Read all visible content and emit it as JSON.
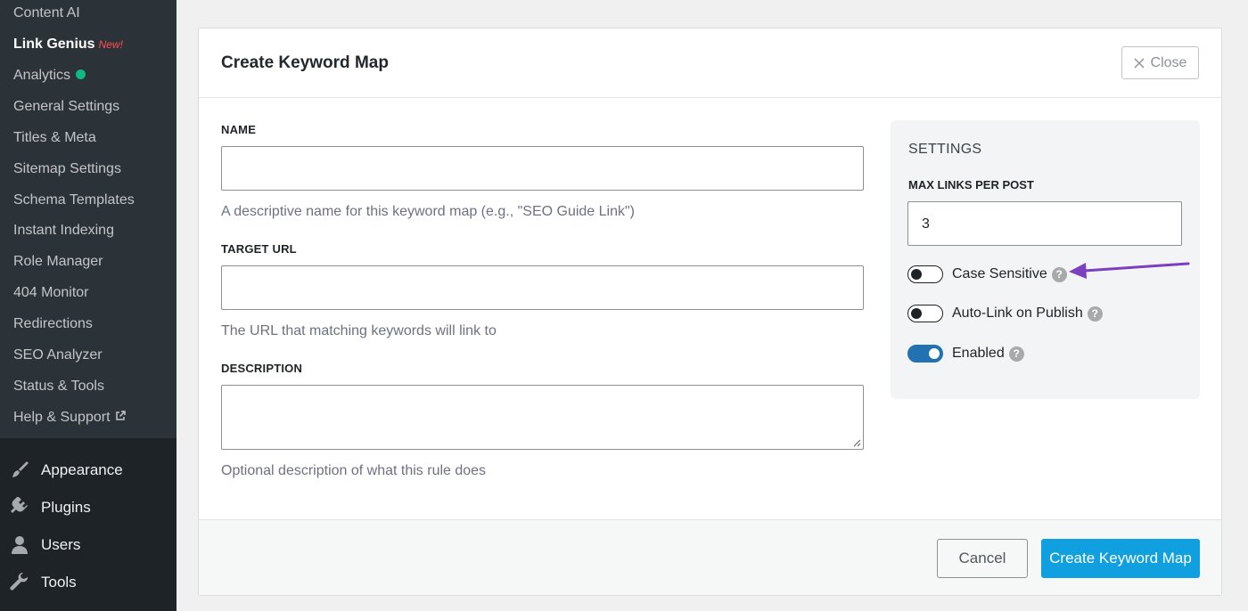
{
  "sidebar": {
    "submenu": [
      {
        "label": "Content AI"
      },
      {
        "label": "Link Genius",
        "badge": "New!"
      },
      {
        "label": "Analytics"
      },
      {
        "label": "General Settings"
      },
      {
        "label": "Titles & Meta"
      },
      {
        "label": "Sitemap Settings"
      },
      {
        "label": "Schema Templates"
      },
      {
        "label": "Instant Indexing"
      },
      {
        "label": "Role Manager"
      },
      {
        "label": "404 Monitor"
      },
      {
        "label": "Redirections"
      },
      {
        "label": "SEO Analyzer"
      },
      {
        "label": "Status & Tools"
      },
      {
        "label": "Help & Support"
      }
    ],
    "menu": [
      {
        "label": "Appearance",
        "icon": "paintbrush-icon"
      },
      {
        "label": "Plugins",
        "icon": "plugin-icon"
      },
      {
        "label": "Users",
        "icon": "user-icon"
      },
      {
        "label": "Tools",
        "icon": "wrench-icon"
      }
    ]
  },
  "modal": {
    "title": "Create Keyword Map",
    "close_label": "Close",
    "fields": {
      "name": {
        "label": "NAME",
        "value": "",
        "help": "A descriptive name for this keyword map (e.g., \"SEO Guide Link\")"
      },
      "target_url": {
        "label": "TARGET URL",
        "value": "",
        "help": "The URL that matching keywords will link to"
      },
      "description": {
        "label": "DESCRIPTION",
        "value": "",
        "help": "Optional description of what this rule does"
      }
    },
    "settings": {
      "title": "SETTINGS",
      "max_links_label": "MAX LINKS PER POST",
      "max_links_value": "3",
      "toggles": [
        {
          "label": "Case Sensitive",
          "on": false
        },
        {
          "label": "Auto-Link on Publish",
          "on": false
        },
        {
          "label": "Enabled",
          "on": true
        }
      ]
    },
    "footer": {
      "cancel_label": "Cancel",
      "create_label": "Create Keyword Map"
    }
  },
  "colors": {
    "sidebar_bg": "#1d2327",
    "submenu_bg": "#2c3338",
    "primary_button": "#10a0df",
    "toggle_on": "#2271b1",
    "analytics_dot": "#10b981",
    "new_badge": "#ff4d4d",
    "annotation_arrow": "#7b3fbf"
  }
}
